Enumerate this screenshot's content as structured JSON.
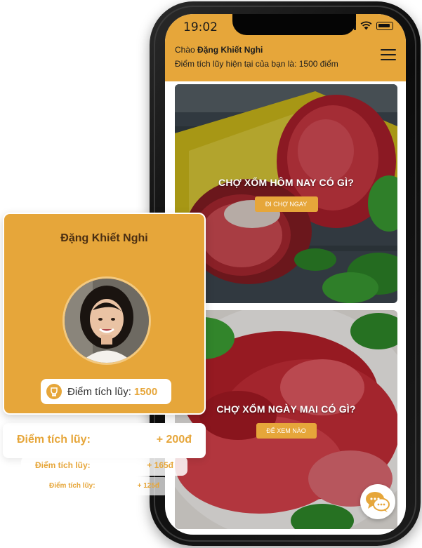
{
  "status_bar": {
    "time": "19:02"
  },
  "header": {
    "greeting_prefix": "Chào ",
    "user_name": "Đặng Khiết Nghi",
    "points_text": "Điểm tích lũy hiện tại của bạn là: 1500 điểm"
  },
  "cards": [
    {
      "title": "CHỢ XỔM HÔM NAY CÓ GÌ?",
      "button": "ĐI CHỢ NGAY"
    },
    {
      "title": "CHỢ XỔM NGÀY MAI CÓ GÌ?",
      "button": "ĐỂ XEM NÀO"
    }
  ],
  "profile": {
    "name": "Đặng Khiết Nghi",
    "points_label": "Điểm tích lũy:",
    "points_value": "1500"
  },
  "point_history": [
    {
      "label": "Điểm tích lũy:",
      "value": "+ 200đ"
    },
    {
      "label": "Điểm tích lũy:",
      "value": "+ 165đ"
    },
    {
      "label": "Điểm tích lũy:",
      "value": "+ 125đ"
    }
  ],
  "icons": {
    "menu": "hamburger-menu-icon",
    "chat": "chat-bubbles-icon",
    "points": "reward-cup-icon"
  },
  "colors": {
    "accent": "#e6a63a",
    "text_dark": "#1d1d1d",
    "name_brown": "#4a2e12"
  }
}
